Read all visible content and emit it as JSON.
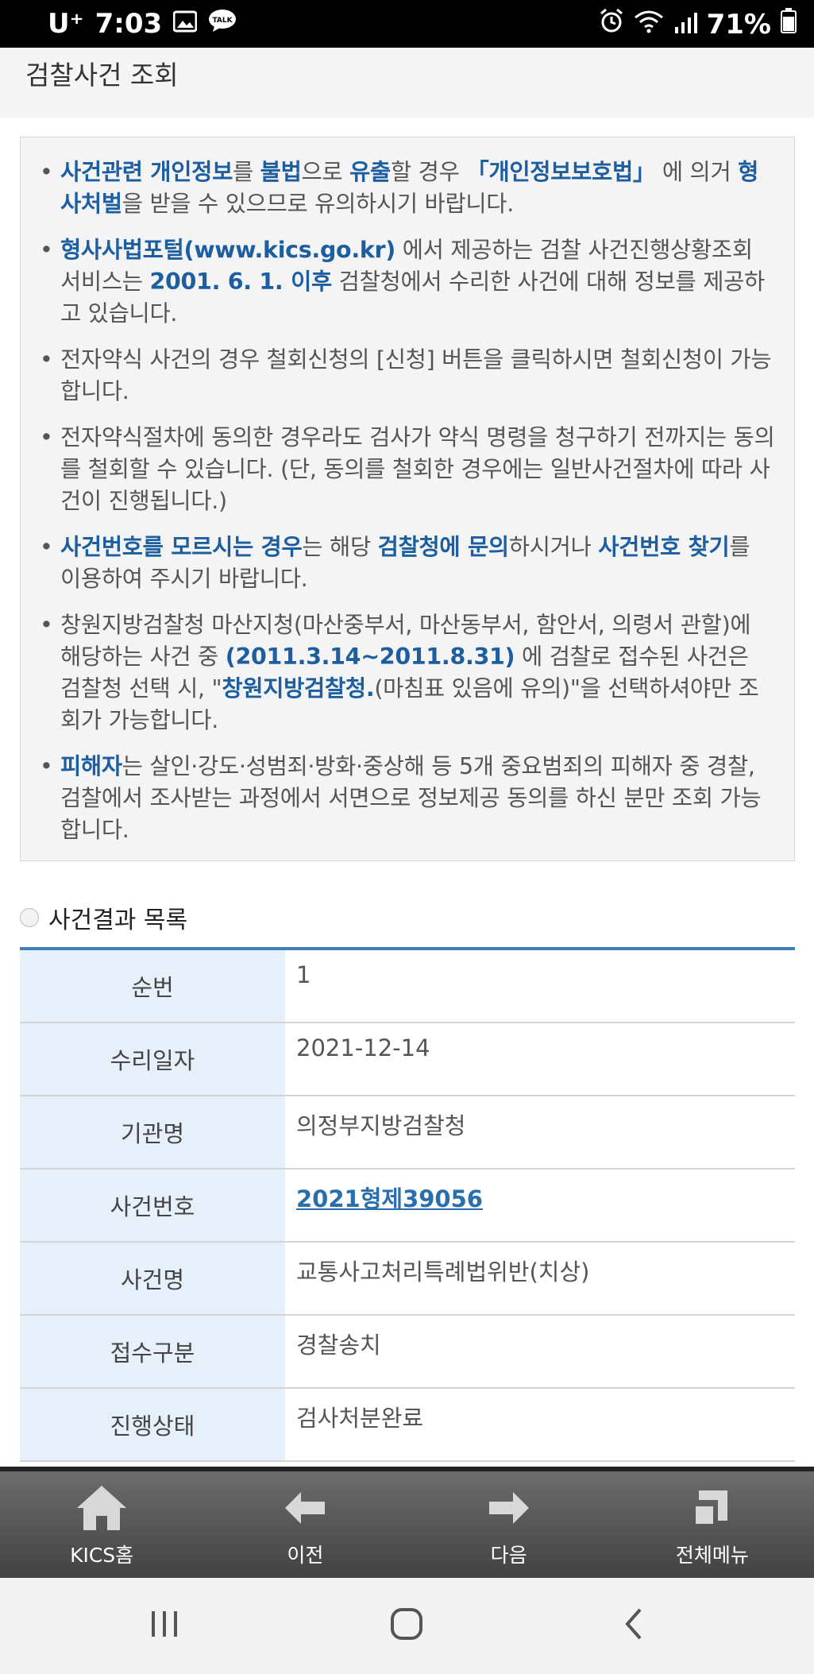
{
  "status": {
    "carrier": "U⁺",
    "time": "7:03",
    "battery": "71%",
    "icons": [
      "image-icon",
      "talk-icon",
      "alarm-icon",
      "wifi-icon",
      "signal-icon",
      "battery-icon"
    ]
  },
  "page": {
    "title": "검찰사건 조회"
  },
  "notice": {
    "items": [
      [
        {
          "t": "사건관련 개인정보",
          "h": true
        },
        {
          "t": "를 ",
          "h": false
        },
        {
          "t": "불법",
          "h": true
        },
        {
          "t": "으로 ",
          "h": false
        },
        {
          "t": "유출",
          "h": true
        },
        {
          "t": "할 경우 ",
          "h": false
        },
        {
          "t": "「개인정보보호법」",
          "h": true
        },
        {
          "t": " 에 의거 ",
          "h": false
        },
        {
          "t": "형사처벌",
          "h": true
        },
        {
          "t": "을 받을 수 있으므로 유의하시기 바랍니다.",
          "h": false
        }
      ],
      [
        {
          "t": "형사사법포털(www.kics.go.kr)",
          "h": true
        },
        {
          "t": " 에서 제공하는 검찰 사건진행상황조회 서비스는 ",
          "h": false
        },
        {
          "t": "2001. 6. 1. 이후",
          "h": true
        },
        {
          "t": " 검찰청에서 수리한 사건에 대해 정보를 제공하고 있습니다.",
          "h": false
        }
      ],
      [
        {
          "t": "전자약식 사건의 경우 철회신청의 [신청] 버튼을 클릭하시면 철회신청이 가능합니다.",
          "h": false
        }
      ],
      [
        {
          "t": "전자약식절차에 동의한 경우라도 검사가 약식 명령을 청구하기 전까지는 동의를 철회할 수 있습니다. (단, 동의를 철회한 경우에는 일반사건절차에 따라 사건이 진행됩니다.)",
          "h": false
        }
      ],
      [
        {
          "t": "사건번호를 모르시는 경우",
          "h": true
        },
        {
          "t": "는 해당 ",
          "h": false
        },
        {
          "t": "검찰청에 문의",
          "h": true
        },
        {
          "t": "하시거나 ",
          "h": false
        },
        {
          "t": "사건번호 찾기",
          "h": true
        },
        {
          "t": "를 이용하여 주시기 바랍니다.",
          "h": false
        }
      ],
      [
        {
          "t": "창원지방검찰청 마산지청(마산중부서, 마산동부서, 함안서, 의령서 관할)에 해당하는 사건 중 ",
          "h": false
        },
        {
          "t": "(2011.3.14~2011.8.31)",
          "h": true
        },
        {
          "t": " 에 검찰로 접수된 사건은 검찰청 선택 시, \"",
          "h": false
        },
        {
          "t": "창원지방검찰청.",
          "h": true
        },
        {
          "t": "(마침표 있음에 유의)\"을 선택하셔야만 조회가 가능합니다.",
          "h": false
        }
      ],
      [
        {
          "t": "피해자",
          "h": true
        },
        {
          "t": "는 살인·강도·성범죄·방화·중상해 등 5개 중요범죄의 피해자 중 경찰, 검찰에서 조사받는 과정에서 서면으로 정보제공 동의를 하신 분만 조회 가능합니다.",
          "h": false
        }
      ]
    ]
  },
  "results": {
    "title": "사건결과 목록",
    "rows": [
      {
        "label": "순번",
        "value": "1",
        "link": false
      },
      {
        "label": "수리일자",
        "value": "2021-12-14",
        "link": false
      },
      {
        "label": "기관명",
        "value": "의정부지방검찰청",
        "link": false
      },
      {
        "label": "사건번호",
        "value": "2021형제39056",
        "link": true
      },
      {
        "label": "사건명",
        "value": "교통사고처리특례법위반(치상)",
        "link": false
      },
      {
        "label": "접수구분",
        "value": "경찰송치",
        "link": false
      },
      {
        "label": "진행상태",
        "value": "검사처분완료",
        "link": false
      }
    ]
  },
  "bottomnav": {
    "items": [
      {
        "label": "KICS홈",
        "icon": "home-icon"
      },
      {
        "label": "이전",
        "icon": "arrow-left-icon"
      },
      {
        "label": "다음",
        "icon": "arrow-right-icon"
      },
      {
        "label": "전체메뉴",
        "icon": "menu-icon"
      }
    ]
  },
  "androidnav": {
    "icons": [
      "recent-apps-icon",
      "home-circle-icon",
      "back-icon"
    ]
  },
  "colors": {
    "accent": "#1c5ea0",
    "table_header_bg": "#e6f0fa",
    "table_top_border": "#3f7fba"
  }
}
